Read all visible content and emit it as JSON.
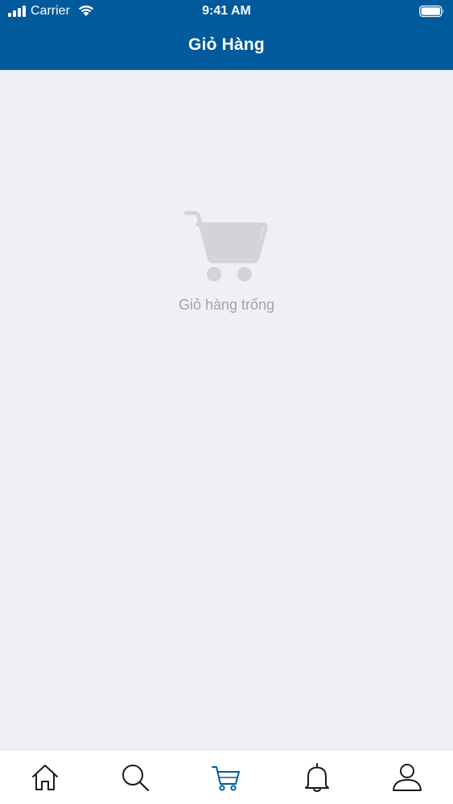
{
  "status_bar": {
    "carrier": "Carrier",
    "time": "9:41 AM"
  },
  "header": {
    "title": "Giỏ Hàng",
    "background": "#005a9c"
  },
  "empty_state": {
    "icon": "shopping-cart-icon",
    "message": "Giỏ hàng trống",
    "icon_color": "#d3d3d8",
    "text_color": "#a3a3ab"
  },
  "tab_bar": {
    "active_color": "#005a9c",
    "inactive_color": "#1a1a1a",
    "tabs": [
      {
        "icon": "home-icon",
        "active": false
      },
      {
        "icon": "search-icon",
        "active": false
      },
      {
        "icon": "cart-icon",
        "active": true
      },
      {
        "icon": "bell-icon",
        "active": false
      },
      {
        "icon": "user-icon",
        "active": false
      }
    ]
  }
}
